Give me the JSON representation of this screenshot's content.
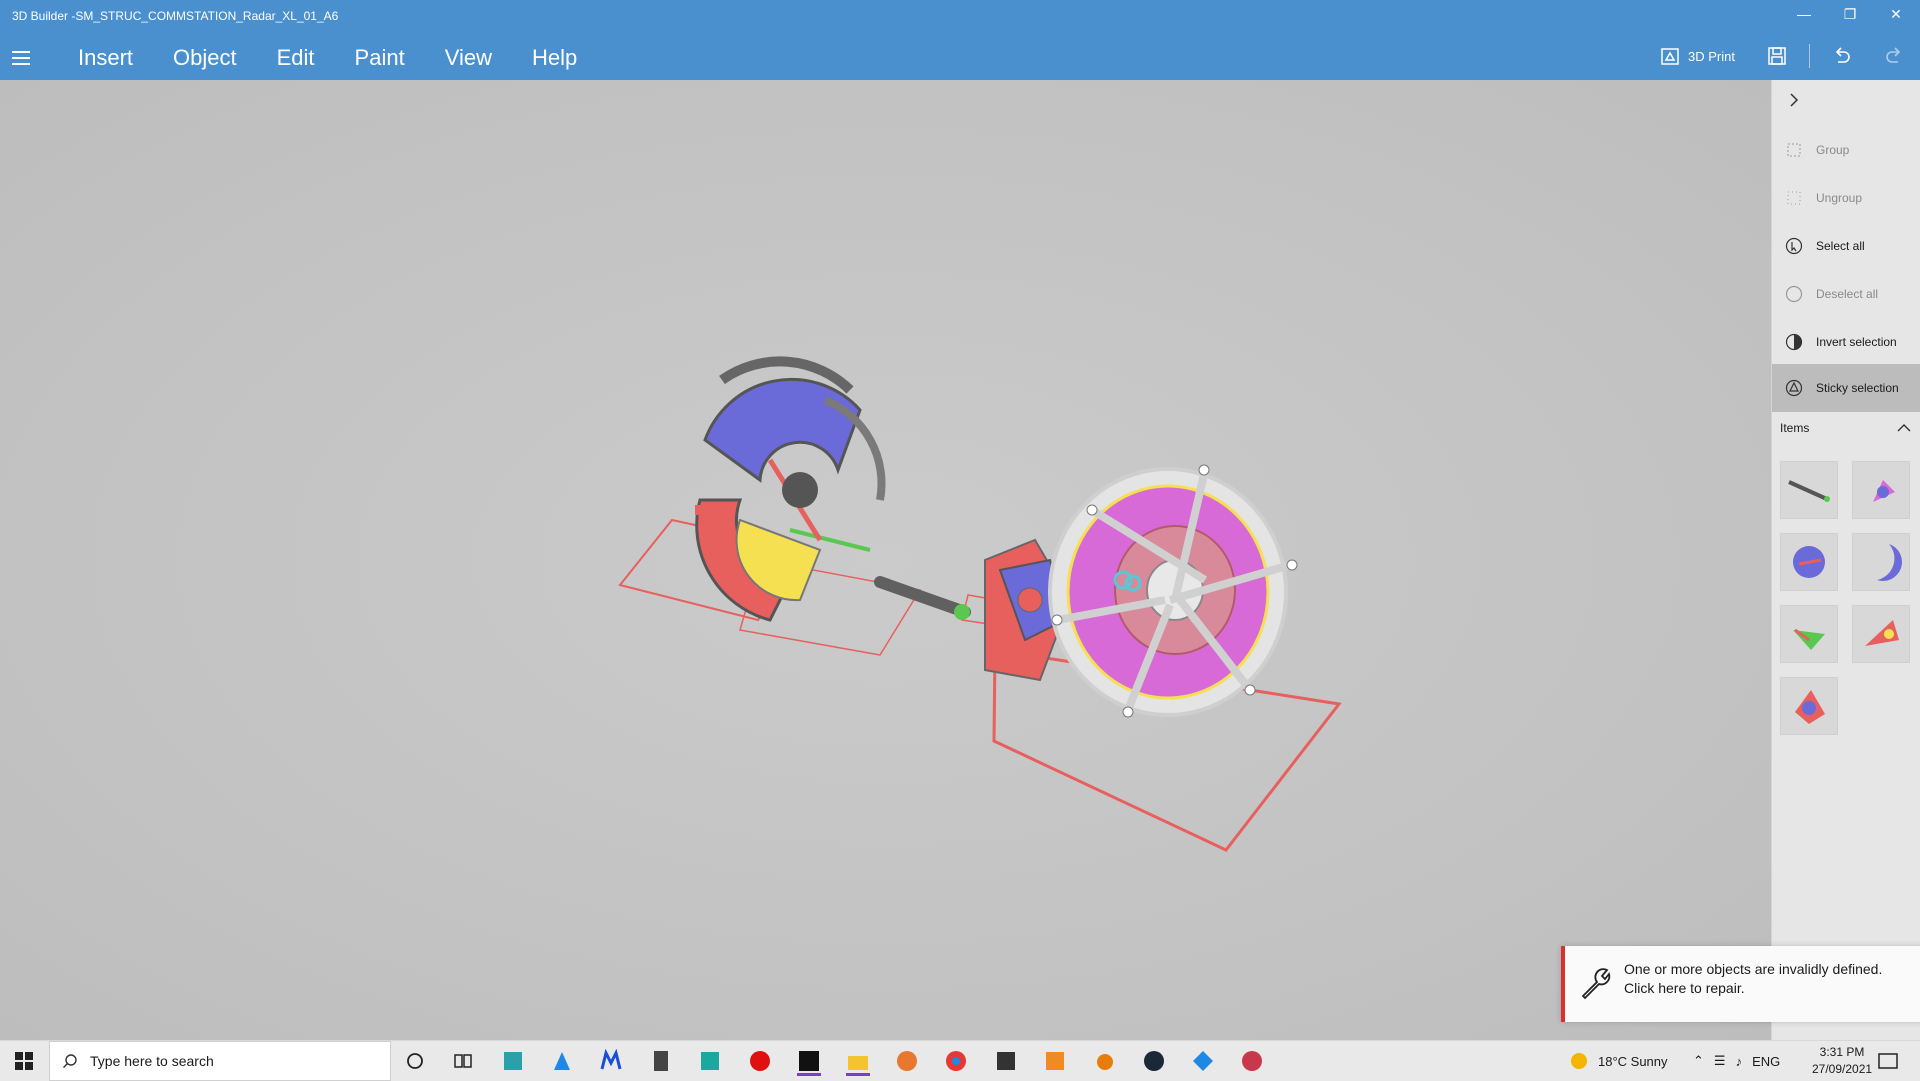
{
  "window": {
    "title": "3D Builder -SM_STRUC_COMMSTATION_Radar_XL_01_A6"
  },
  "menu": {
    "items": [
      "Insert",
      "Object",
      "Edit",
      "Paint",
      "View",
      "Help"
    ]
  },
  "toolbar": {
    "print_label": "3D Print"
  },
  "side_panel": {
    "actions": [
      {
        "label": "Group",
        "state": "disabled",
        "icon": "group-icon"
      },
      {
        "label": "Ungroup",
        "state": "disabled",
        "icon": "ungroup-icon"
      },
      {
        "label": "Select all",
        "state": "enabled",
        "icon": "select-all-icon"
      },
      {
        "label": "Deselect all",
        "state": "disabled",
        "icon": "deselect-all-icon"
      },
      {
        "label": "Invert selection",
        "state": "enabled",
        "icon": "invert-selection-icon"
      },
      {
        "label": "Sticky selection",
        "state": "active",
        "icon": "sticky-selection-icon"
      }
    ],
    "items_label": "Items"
  },
  "notification": {
    "line1": "One or more objects are invalidly defined.",
    "line2": "Click here to repair."
  },
  "taskbar": {
    "search_placeholder": "Type here to search",
    "weather": "18°C  Sunny",
    "lang": "ENG",
    "time": "3:31 PM",
    "date": "27/09/2021"
  },
  "colors": {
    "titlebar": "#4a90cf",
    "model_red": "#e8605e",
    "model_magenta": "#d86ad8",
    "model_blue": "#6a6ad8",
    "notification_accent": "#d6322f"
  }
}
